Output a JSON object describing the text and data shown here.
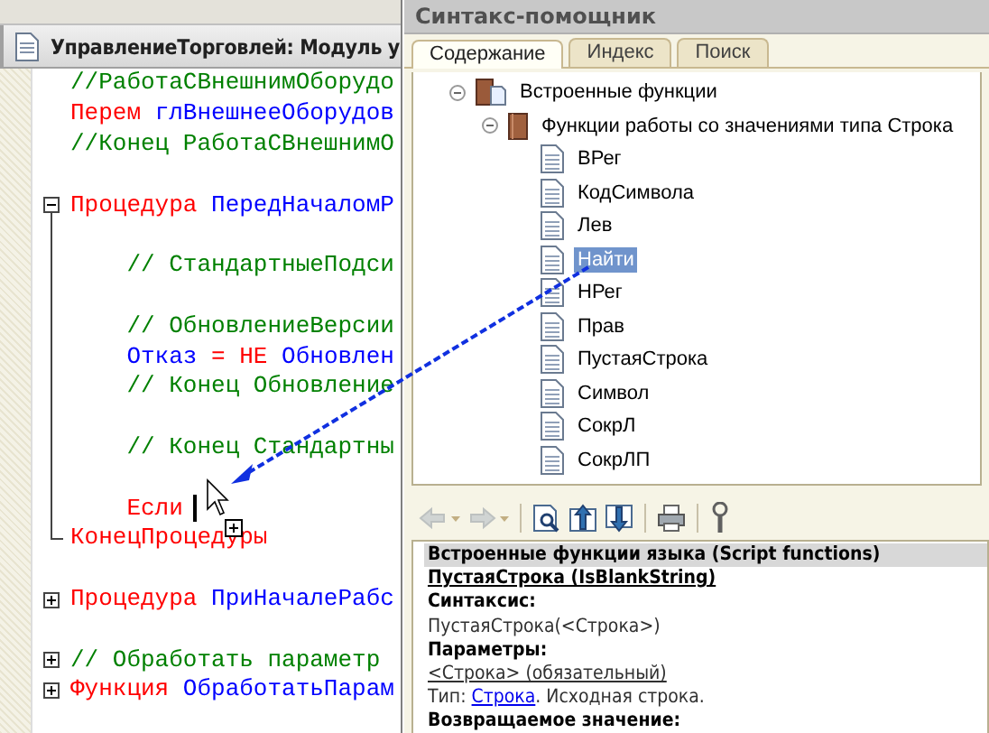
{
  "editor": {
    "title": "УправлениеТорговлей: Модуль у",
    "lines": [
      {
        "kind": "code",
        "tokens": [
          {
            "kind": "comment",
            "text": "//РаботаСВнешнимОборудо"
          }
        ]
      },
      {
        "kind": "code",
        "tokens": [
          {
            "kind": "keyword",
            "text": "Перем"
          },
          {
            "kind": "ident",
            "text": " глВнешнееОборудов"
          }
        ]
      },
      {
        "kind": "code",
        "tokens": [
          {
            "kind": "comment",
            "text": "//Конец РаботаСВнешнимО"
          }
        ]
      },
      {
        "kind": "blank"
      },
      {
        "kind": "code",
        "expanded": true,
        "tokens": [
          {
            "kind": "keyword",
            "text": "Процедура"
          },
          {
            "kind": "ident",
            "text": " ПередНачаломР"
          }
        ]
      },
      {
        "kind": "blank"
      },
      {
        "kind": "code",
        "tokens": [
          {
            "kind": "comment",
            "text": "    // СтандартныеПодси"
          }
        ]
      },
      {
        "kind": "blank"
      },
      {
        "kind": "code",
        "tokens": [
          {
            "kind": "comment",
            "text": "    // ОбновлениеВерсии"
          }
        ]
      },
      {
        "kind": "code",
        "tokens": [
          {
            "kind": "ident",
            "text": "    Отказ "
          },
          {
            "kind": "keyword",
            "text": "= НЕ"
          },
          {
            "kind": "ident",
            "text": " Обновлен"
          }
        ]
      },
      {
        "kind": "code",
        "tokens": [
          {
            "kind": "comment",
            "text": "    // Конец Обновление"
          }
        ]
      },
      {
        "kind": "blank"
      },
      {
        "kind": "code",
        "tokens": [
          {
            "kind": "comment",
            "text": "    // Конец Стандартны"
          }
        ]
      },
      {
        "kind": "blank"
      },
      {
        "kind": "code",
        "tokens": [
          {
            "kind": "keyword",
            "text": "    Если"
          }
        ],
        "caret": true
      },
      {
        "kind": "code",
        "block_end": true,
        "tokens": [
          {
            "kind": "keyword",
            "text": "КонецПроцедуры"
          }
        ]
      },
      {
        "kind": "blank"
      },
      {
        "kind": "code",
        "expanded": false,
        "tokens": [
          {
            "kind": "keyword",
            "text": "Процедура"
          },
          {
            "kind": "ident",
            "text": " ПриНачалеРабс"
          }
        ]
      },
      {
        "kind": "blank"
      },
      {
        "kind": "code",
        "expanded": false,
        "tokens": [
          {
            "kind": "comment",
            "text": "// Обработать параметр"
          }
        ]
      },
      {
        "kind": "code",
        "expanded": false,
        "tokens": [
          {
            "kind": "keyword",
            "text": "Функция"
          },
          {
            "kind": "ident",
            "text": " ОбработатьПарам"
          }
        ]
      }
    ]
  },
  "helper": {
    "title": "Синтакс-помощник",
    "tabs": [
      {
        "label": "Содержание",
        "selected": true
      },
      {
        "label": "Индекс",
        "selected": false
      },
      {
        "label": "Поиск",
        "selected": false
      }
    ],
    "tree": [
      {
        "label": "Встроенные функции",
        "kind": "book-page",
        "expanded": true,
        "selected": false,
        "children": [
          {
            "label": "Функции работы со значениями типа Строка",
            "kind": "book",
            "expanded": true,
            "selected": false,
            "children": [
              {
                "label": "ВРег",
                "kind": "page",
                "selected": false
              },
              {
                "label": "КодСимвола",
                "kind": "page",
                "selected": false
              },
              {
                "label": "Лев",
                "kind": "page",
                "selected": false
              },
              {
                "label": "Найти",
                "kind": "page",
                "selected": true
              },
              {
                "label": "НРег",
                "kind": "page",
                "selected": false
              },
              {
                "label": "Прав",
                "kind": "page",
                "selected": false
              },
              {
                "label": "ПустаяСтрока",
                "kind": "page",
                "selected": false
              },
              {
                "label": "Символ",
                "kind": "page",
                "selected": false
              },
              {
                "label": "СокрЛ",
                "kind": "page",
                "selected": false
              },
              {
                "label": "СокрЛП",
                "kind": "page",
                "selected": false
              }
            ]
          }
        ]
      }
    ],
    "toolbar": [
      {
        "kind": "back",
        "disabled": true
      },
      {
        "kind": "forward",
        "disabled": true
      },
      {
        "kind": "find",
        "disabled": false
      },
      {
        "kind": "up",
        "disabled": false
      },
      {
        "kind": "down",
        "disabled": false
      },
      {
        "kind": "print",
        "disabled": false
      },
      {
        "kind": "settings",
        "disabled": false
      }
    ],
    "help": [
      {
        "kind": "section",
        "text": "Встроенные функции языка (Script functions)"
      },
      {
        "kind": "title",
        "text": "ПустаяСтрока (IsBlankString)"
      },
      {
        "kind": "label",
        "text": "Синтаксис:"
      },
      {
        "kind": "text",
        "text": "ПустаяСтрока(<Строка>)"
      },
      {
        "kind": "label",
        "text": "Параметры:"
      },
      {
        "kind": "param",
        "text": "<Строка> (обязательный)"
      },
      {
        "kind": "type",
        "prefix": "Тип: ",
        "link": "Строка",
        "suffix": ". Исходная строка."
      },
      {
        "kind": "label",
        "text": "Возвращаемое значение:"
      }
    ]
  }
}
